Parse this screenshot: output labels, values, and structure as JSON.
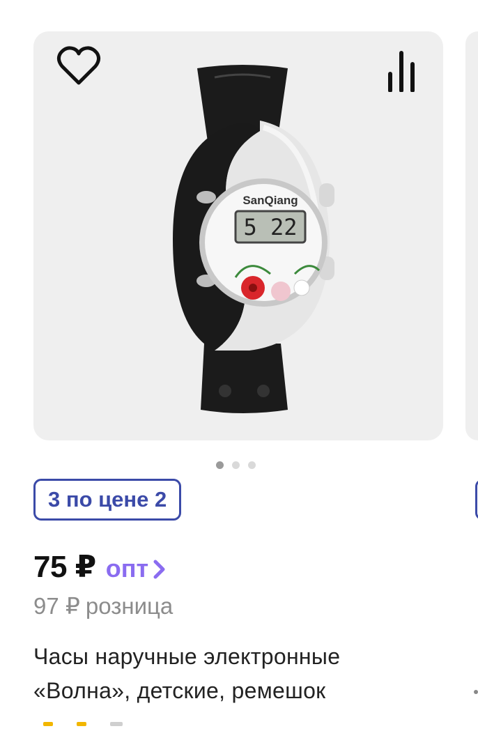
{
  "product": {
    "promo_badge": "3 по цене 2",
    "price_wholesale": "75 ₽",
    "price_wholesale_label": "опт",
    "price_retail": "97 ₽",
    "price_retail_label": "розница",
    "title_line1": "Часы наручные электронные",
    "title_line2": "«Волна», детские, ремешок",
    "watch_brand": "SanQiang",
    "watch_display": "5 22"
  },
  "gallery": {
    "image_count": 3,
    "active_index": 0
  },
  "icons": {
    "favorite": "heart-icon",
    "compare": "compare-bars-icon",
    "price_arrow": "chevron-right-icon"
  },
  "colors": {
    "accent_blue": "#3b4aa8",
    "accent_purple": "#8a6cf0",
    "muted_text": "#8c8c8c",
    "image_bg": "#efefef"
  }
}
